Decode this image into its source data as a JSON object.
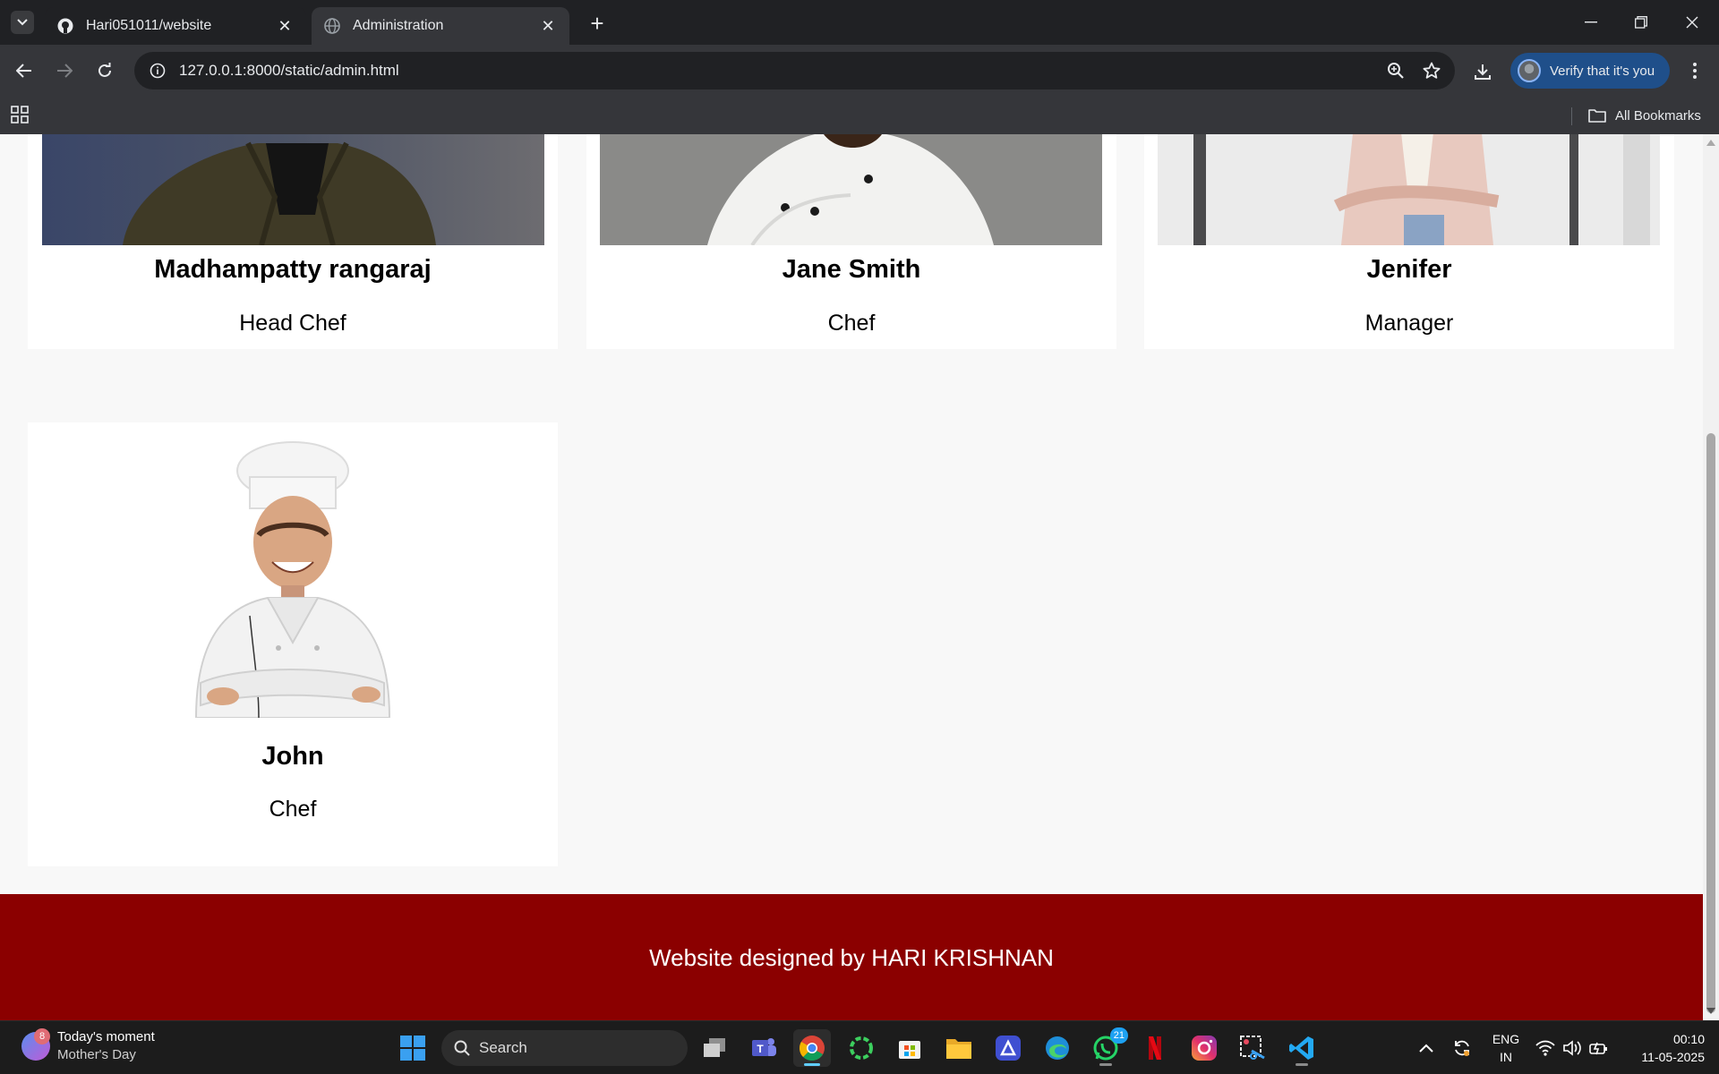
{
  "browser": {
    "tabs": [
      {
        "title": "Hari051011/website",
        "icon": "github-icon",
        "active": false
      },
      {
        "title": "Administration",
        "icon": "globe-icon",
        "active": true
      }
    ],
    "url": "127.0.0.1:8000/static/admin.html",
    "verify_label": "Verify that it's you",
    "all_bookmarks_label": "All Bookmarks"
  },
  "staff": [
    {
      "name": "Madhampatty rangaraj",
      "role": "Head Chef"
    },
    {
      "name": "Jane Smith",
      "role": "Chef"
    },
    {
      "name": "Jenifer",
      "role": "Manager"
    },
    {
      "name": "John",
      "role": "Chef"
    }
  ],
  "footer": {
    "text": "Website designed by HARI KRISHNAN",
    "color": "#8b0000"
  },
  "taskbar": {
    "widget_badge": "8",
    "widget_title": "Today's moment",
    "widget_subtitle": "Mother's Day",
    "search_placeholder": "Search",
    "whatsapp_badge": "21",
    "lang_top": "ENG",
    "lang_bottom": "IN",
    "time": "00:10",
    "date": "11-05-2025"
  }
}
